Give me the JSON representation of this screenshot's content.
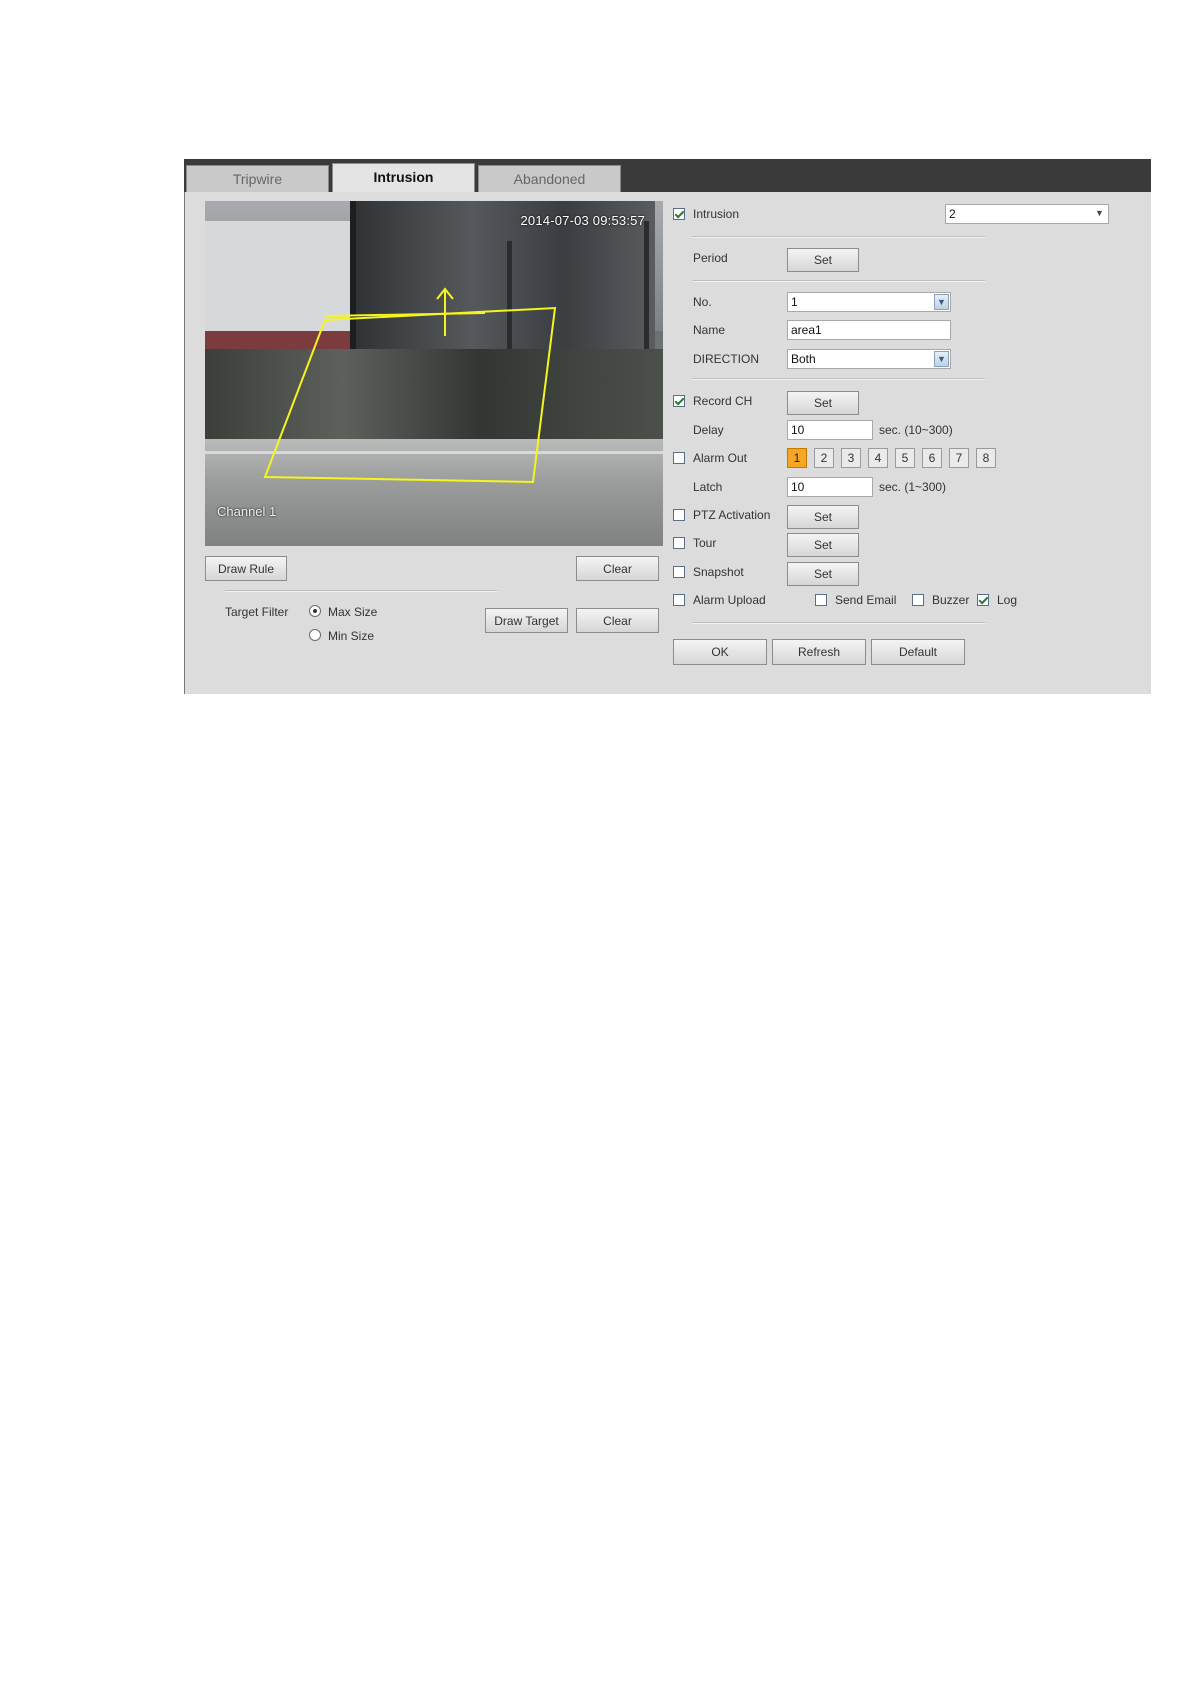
{
  "tabs": [
    {
      "label": "Tripwire",
      "active": false
    },
    {
      "label": "Intrusion",
      "active": true
    },
    {
      "label": "Abandoned",
      "active": false
    }
  ],
  "video": {
    "timestamp": "2014-07-03 09:53:57",
    "channel_label": "Channel 1",
    "rule_color": "#f5f51e"
  },
  "left": {
    "draw_rule": "Draw Rule",
    "clear_rule": "Clear",
    "target_filter_label": "Target Filter",
    "max_size": "Max Size",
    "min_size": "Min Size",
    "selected_size": "Max Size",
    "draw_target": "Draw Target",
    "clear_target": "Clear"
  },
  "right": {
    "intrusion": {
      "label": "Intrusion",
      "checked": true,
      "channel": "2"
    },
    "period": {
      "label": "Period",
      "button": "Set"
    },
    "no": {
      "label": "No.",
      "value": "1"
    },
    "name": {
      "label": "Name",
      "value": "area1"
    },
    "direction": {
      "label": "DIRECTION",
      "value": "Both"
    },
    "record_ch": {
      "label": "Record CH",
      "checked": true,
      "button": "Set"
    },
    "delay": {
      "label": "Delay",
      "value": "10",
      "unit": "sec. (10~300)"
    },
    "alarm_out": {
      "label": "Alarm Out",
      "checked": false,
      "channels": [
        "1",
        "2",
        "3",
        "4",
        "5",
        "6",
        "7",
        "8"
      ],
      "selected": "1"
    },
    "latch": {
      "label": "Latch",
      "value": "10",
      "unit": "sec. (1~300)"
    },
    "ptz": {
      "label": "PTZ Activation",
      "checked": false,
      "button": "Set"
    },
    "tour": {
      "label": "Tour",
      "checked": false,
      "button": "Set"
    },
    "snapshot": {
      "label": "Snapshot",
      "checked": false,
      "button": "Set"
    },
    "alarm_upload": {
      "label": "Alarm Upload",
      "checked": false
    },
    "send_email": {
      "label": "Send Email",
      "checked": false
    },
    "buzzer": {
      "label": "Buzzer",
      "checked": false
    },
    "log": {
      "label": "Log",
      "checked": true
    }
  },
  "footer": {
    "ok": "OK",
    "refresh": "Refresh",
    "default": "Default"
  }
}
